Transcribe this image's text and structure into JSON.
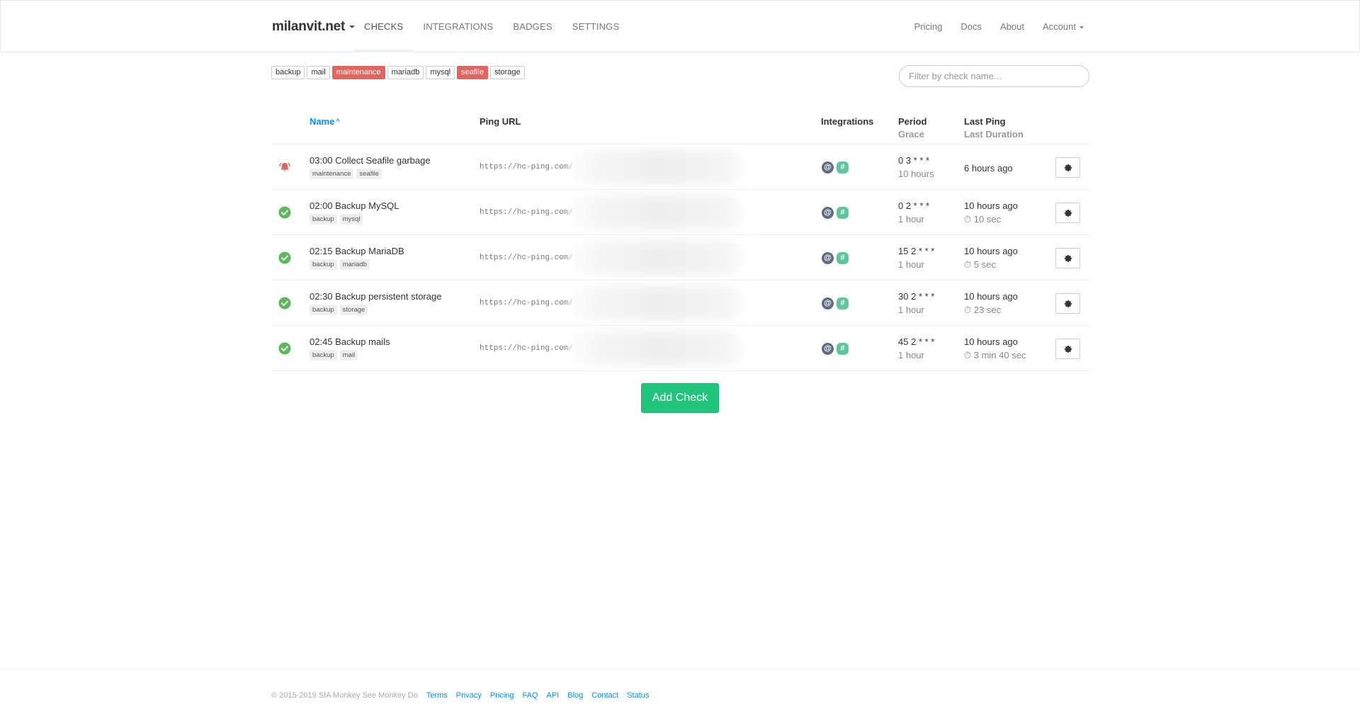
{
  "navbar": {
    "brand": "milanvit.net",
    "left_links": [
      {
        "label": "CHECKS",
        "active": true
      },
      {
        "label": "INTEGRATIONS",
        "active": false
      },
      {
        "label": "BADGES",
        "active": false
      },
      {
        "label": "SETTINGS",
        "active": false
      }
    ],
    "right_links": [
      "Pricing",
      "Docs",
      "About",
      "Account"
    ]
  },
  "tag_filters": [
    {
      "label": "backup",
      "status": "up"
    },
    {
      "label": "mail",
      "status": "up"
    },
    {
      "label": "maintenance",
      "status": "down"
    },
    {
      "label": "mariadb",
      "status": "up"
    },
    {
      "label": "mysql",
      "status": "up"
    },
    {
      "label": "seafile",
      "status": "down"
    },
    {
      "label": "storage",
      "status": "up"
    }
  ],
  "search": {
    "placeholder": "Filter by check name...",
    "value": ""
  },
  "colors": {
    "accent": "#0091ea",
    "down": "#e2655f",
    "up": "#5cb85c",
    "add_button": "#22c47b"
  },
  "table": {
    "headers": {
      "name": "Name",
      "sort_indicator": "^",
      "ping_url": "Ping URL",
      "integrations": "Integrations",
      "period": "Period",
      "grace": "Grace",
      "last_ping": "Last Ping",
      "last_duration": "Last Duration"
    },
    "rows": [
      {
        "status": "down",
        "status_icon": "bell-icon",
        "name": "03:00 Collect Seafile garbage",
        "tags": [
          "maintenance",
          "seafile"
        ],
        "ping_url": "https://hc-ping.com/",
        "integrations": [
          "email-icon",
          "slack-icon"
        ],
        "period": "0 3 * * *",
        "grace": "10 hours",
        "last_ping": "6 hours ago",
        "last_duration": ""
      },
      {
        "status": "up",
        "status_icon": "check-circle-icon",
        "name": "02:00 Backup MySQL",
        "tags": [
          "backup",
          "mysql"
        ],
        "ping_url": "https://hc-ping.com/",
        "integrations": [
          "email-icon",
          "slack-icon"
        ],
        "period": "0 2 * * *",
        "grace": "1 hour",
        "last_ping": "10 hours ago",
        "last_duration": "10 sec"
      },
      {
        "status": "up",
        "status_icon": "check-circle-icon",
        "name": "02:15 Backup MariaDB",
        "tags": [
          "backup",
          "mariadb"
        ],
        "ping_url": "https://hc-ping.com/",
        "integrations": [
          "email-icon",
          "slack-icon"
        ],
        "period": "15 2 * * *",
        "grace": "1 hour",
        "last_ping": "10 hours ago",
        "last_duration": "5 sec"
      },
      {
        "status": "up",
        "status_icon": "check-circle-icon",
        "name": "02:30 Backup persistent storage",
        "tags": [
          "backup",
          "storage"
        ],
        "ping_url": "https://hc-ping.com/",
        "integrations": [
          "email-icon",
          "slack-icon"
        ],
        "period": "30 2 * * *",
        "grace": "1 hour",
        "last_ping": "10 hours ago",
        "last_duration": "23 sec"
      },
      {
        "status": "up",
        "status_icon": "check-circle-icon",
        "name": "02:45 Backup mails",
        "tags": [
          "backup",
          "mail"
        ],
        "ping_url": "https://hc-ping.com/",
        "integrations": [
          "email-icon",
          "slack-icon"
        ],
        "period": "45 2 * * *",
        "grace": "1 hour",
        "last_ping": "10 hours ago",
        "last_duration": "3 min 40 sec"
      }
    ]
  },
  "add_check_label": "Add Check",
  "footer": {
    "copyright": "© 2015-2019 SIA Monkey See Monkey Do",
    "links": [
      "Terms",
      "Privacy",
      "Pricing",
      "FAQ",
      "API",
      "Blog",
      "Contact",
      "Status"
    ]
  }
}
